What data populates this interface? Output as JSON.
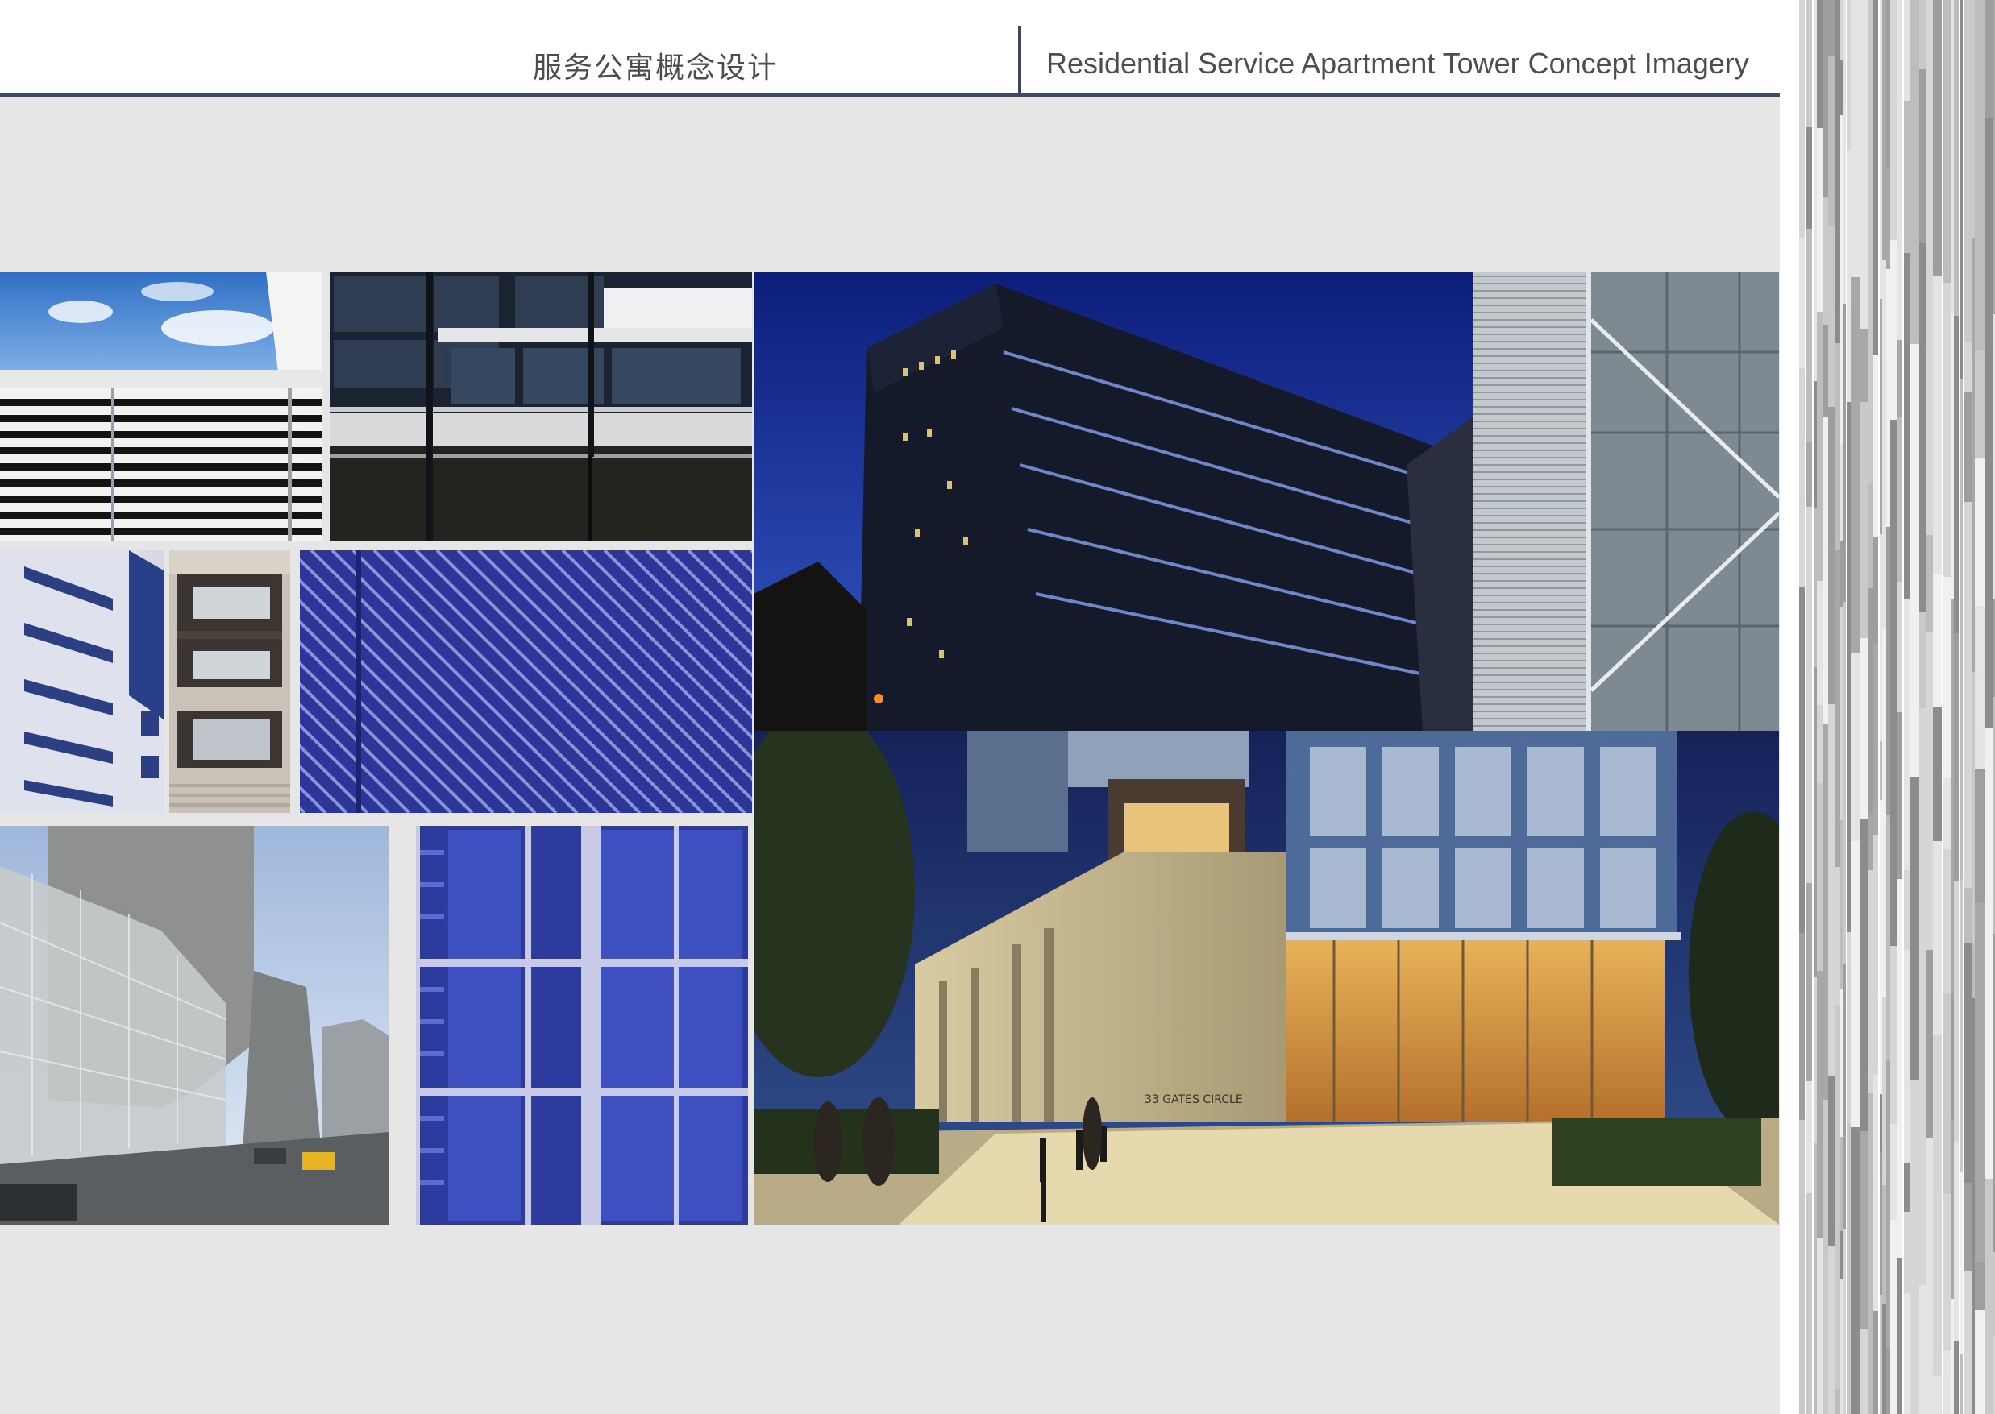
{
  "header": {
    "title_cn": "服务公寓概念设计",
    "title_en": "Residential Service Apartment Tower Concept Imagery"
  },
  "photos": [
    {
      "name": "louver-facade-sky-photo"
    },
    {
      "name": "glass-balcony-facade-photo"
    },
    {
      "name": "white-facade-strip-windows-photo"
    },
    {
      "name": "stone-window-grid-photo"
    },
    {
      "name": "blue-louver-closeup-photo"
    },
    {
      "name": "night-office-tower-photo"
    },
    {
      "name": "vertical-louver-screen-photo"
    },
    {
      "name": "street-glass-building-render-photo"
    },
    {
      "name": "blue-curtain-wall-photo"
    },
    {
      "name": "apartment-entrance-night-render-photo"
    }
  ],
  "signage": {
    "address": "33 GATES CIRCLE"
  },
  "colors": {
    "header_rule": "#404a66",
    "title_text": "#4d4d4d",
    "content_background": "#e6e6e6"
  }
}
